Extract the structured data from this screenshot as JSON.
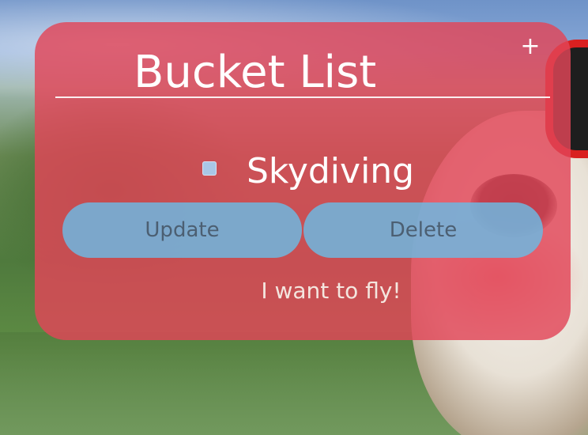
{
  "card": {
    "title": "Bucket List",
    "add_label": "+",
    "colors": {
      "card_background": "#e24658",
      "button_background": "#6fb7e1",
      "text": "#ffffff"
    }
  },
  "items": [
    {
      "label": "Skydiving",
      "checked": false,
      "update_label": "Update",
      "delete_label": "Delete",
      "note": "I want to fly!"
    }
  ]
}
